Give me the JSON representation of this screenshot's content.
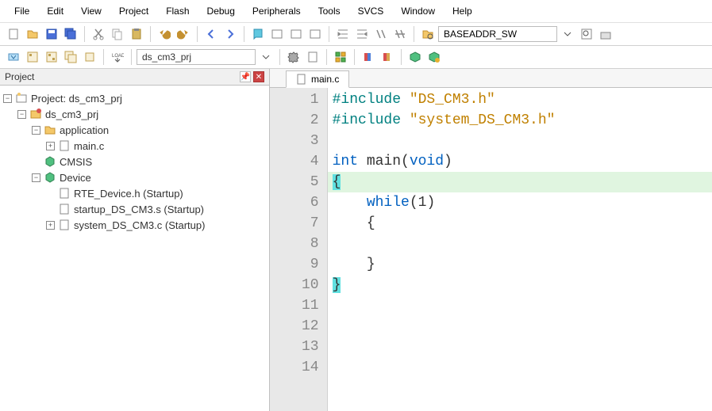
{
  "menu": {
    "items": [
      "File",
      "Edit",
      "View",
      "Project",
      "Flash",
      "Debug",
      "Peripherals",
      "Tools",
      "SVCS",
      "Window",
      "Help"
    ]
  },
  "toolbar2": {
    "target": "ds_cm3_prj"
  },
  "searchbox": {
    "value": "BASEADDR_SW"
  },
  "project_panel": {
    "title": "Project",
    "root": "Project: ds_cm3_prj",
    "target": "ds_cm3_prj",
    "folders": {
      "app": "application",
      "app_file": "main.c",
      "cmsis": "CMSIS",
      "device": "Device",
      "dev_files": [
        "RTE_Device.h (Startup)",
        "startup_DS_CM3.s (Startup)",
        "system_DS_CM3.c (Startup)"
      ]
    }
  },
  "editor": {
    "tab": "main.c",
    "line_count": 14,
    "code": {
      "l1_pp": "#include ",
      "l1_str": "\"DS_CM3.h\"",
      "l2_pp": "#include ",
      "l2_str": "\"system_DS_CM3.h\"",
      "l4_kw1": "int",
      "l4_mid": " main(",
      "l4_kw2": "void",
      "l4_end": ")",
      "l5": "{",
      "l6_pre": "    ",
      "l6_kw": "while",
      "l6_post": "(1)",
      "l7": "    {",
      "l9": "    }",
      "l10": "}"
    }
  }
}
